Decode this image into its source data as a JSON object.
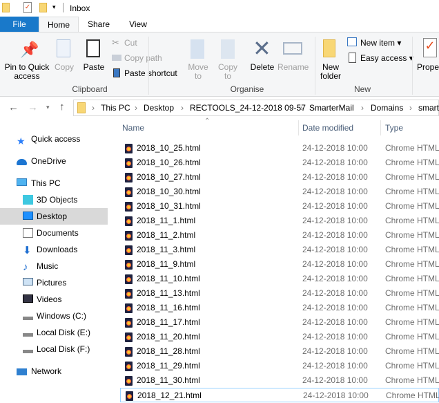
{
  "window": {
    "title": "Inbox"
  },
  "tabs": [
    {
      "label": "File"
    },
    {
      "label": "Home"
    },
    {
      "label": "Share"
    },
    {
      "label": "View"
    }
  ],
  "ribbon": {
    "clipboard": {
      "group": "Clipboard",
      "pin1": "Pin to Quick",
      "pin2": "access",
      "copy": "Copy",
      "paste": "Paste",
      "cut": "Cut",
      "copy_path": "Copy path",
      "paste_shortcut": "Paste shortcut"
    },
    "organise": {
      "group": "Organise",
      "move1": "Move",
      "move2": "to",
      "copy1": "Copy",
      "copy2": "to",
      "delete": "Delete",
      "rename": "Rename"
    },
    "new": {
      "group": "New",
      "new_folder1": "New",
      "new_folder2": "folder",
      "new_item": "New item",
      "easy_access": "Easy access"
    },
    "open": {
      "properties": "Prope"
    }
  },
  "address": {
    "crumbs": [
      "This PC",
      "Desktop",
      "RECTOOLS_24-12-2018 09-57",
      "SmarterMail",
      "Domains",
      "smart"
    ]
  },
  "sidebar": {
    "items": [
      {
        "label": "Quick access",
        "icon": "star-icon"
      },
      {
        "label": "OneDrive",
        "icon": "cloud-icon"
      },
      {
        "label": "This PC",
        "icon": "computer-icon"
      },
      {
        "label": "3D Objects",
        "icon": "cube-icon"
      },
      {
        "label": "Desktop",
        "icon": "desktop-icon",
        "selected": true
      },
      {
        "label": "Documents",
        "icon": "document-icon"
      },
      {
        "label": "Downloads",
        "icon": "download-icon"
      },
      {
        "label": "Music",
        "icon": "music-icon"
      },
      {
        "label": "Pictures",
        "icon": "picture-icon"
      },
      {
        "label": "Videos",
        "icon": "video-icon"
      },
      {
        "label": "Windows (C:)",
        "icon": "drive-icon"
      },
      {
        "label": "Local Disk (E:)",
        "icon": "drive-icon"
      },
      {
        "label": "Local Disk (F:)",
        "icon": "drive-icon"
      },
      {
        "label": "Network",
        "icon": "network-icon"
      }
    ]
  },
  "columns": {
    "name": "Name",
    "date": "Date modified",
    "type": "Type"
  },
  "files": [
    {
      "name": "2018_10_25.html",
      "date": "24-12-2018 10:00",
      "type": "Chrome HTML"
    },
    {
      "name": "2018_10_26.html",
      "date": "24-12-2018 10:00",
      "type": "Chrome HTML"
    },
    {
      "name": "2018_10_27.html",
      "date": "24-12-2018 10:00",
      "type": "Chrome HTML"
    },
    {
      "name": "2018_10_30.html",
      "date": "24-12-2018 10:00",
      "type": "Chrome HTML"
    },
    {
      "name": "2018_10_31.html",
      "date": "24-12-2018 10:00",
      "type": "Chrome HTML"
    },
    {
      "name": "2018_11_1.html",
      "date": "24-12-2018 10:00",
      "type": "Chrome HTML"
    },
    {
      "name": "2018_11_2.html",
      "date": "24-12-2018 10:00",
      "type": "Chrome HTML"
    },
    {
      "name": "2018_11_3.html",
      "date": "24-12-2018 10:00",
      "type": "Chrome HTML"
    },
    {
      "name": "2018_11_9.html",
      "date": "24-12-2018 10:00",
      "type": "Chrome HTML"
    },
    {
      "name": "2018_11_10.html",
      "date": "24-12-2018 10:00",
      "type": "Chrome HTML"
    },
    {
      "name": "2018_11_13.html",
      "date": "24-12-2018 10:00",
      "type": "Chrome HTML"
    },
    {
      "name": "2018_11_16.html",
      "date": "24-12-2018 10:00",
      "type": "Chrome HTML"
    },
    {
      "name": "2018_11_17.html",
      "date": "24-12-2018 10:00",
      "type": "Chrome HTML"
    },
    {
      "name": "2018_11_20.html",
      "date": "24-12-2018 10:00",
      "type": "Chrome HTML"
    },
    {
      "name": "2018_11_28.html",
      "date": "24-12-2018 10:00",
      "type": "Chrome HTML"
    },
    {
      "name": "2018_11_29.html",
      "date": "24-12-2018 10:00",
      "type": "Chrome HTML"
    },
    {
      "name": "2018_11_30.html",
      "date": "24-12-2018 10:00",
      "type": "Chrome HTML"
    },
    {
      "name": "2018_12_21.html",
      "date": "24-12-2018 10:00",
      "type": "Chrome HTML"
    }
  ],
  "colors": {
    "file_tab": "#1979ca",
    "selected": "#d9d9d9",
    "focus": "#99d1ff"
  }
}
